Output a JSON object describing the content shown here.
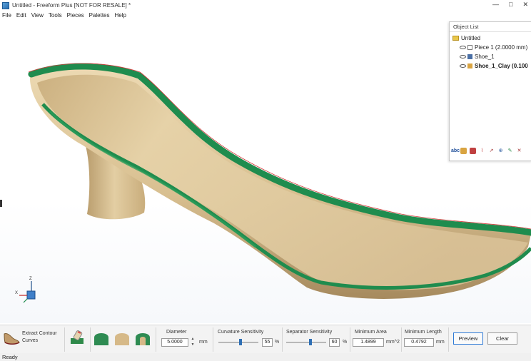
{
  "window": {
    "title": "Untitled - Freeform Plus [NOT FOR RESALE] *",
    "controls": [
      "—",
      "□",
      "✕"
    ]
  },
  "menu": [
    "File",
    "Edit",
    "View",
    "Tools",
    "Pieces",
    "Palettes",
    "Help"
  ],
  "object_list": {
    "header": "Object List",
    "root": "Untitled",
    "items": [
      {
        "label": "Piece 1 (2.0000 mm)",
        "icon": "piece-icon",
        "bold": false
      },
      {
        "label": "Shoe_1",
        "icon": "mesh-icon",
        "bold": false
      },
      {
        "label": "Shoe_1_Clay (0.100",
        "icon": "clay-icon",
        "bold": true
      }
    ],
    "toolbar_first": "abc"
  },
  "axis": {
    "x": "X",
    "z": "Z"
  },
  "toolbar": {
    "extract_label_line1": "Extract Contour",
    "extract_label_line2": "Curves",
    "diameter": {
      "label": "Diameter",
      "value": "5.0000",
      "unit": "mm"
    },
    "curvature": {
      "label": "Curvature Sensitivity",
      "value": "55",
      "unit": "%",
      "level": 0.55
    },
    "separator": {
      "label": "Separator Sensitivity",
      "value": "60",
      "unit": "%",
      "level": 0.6
    },
    "min_area": {
      "label": "Minimum Area",
      "value": "1.4899",
      "unit": "mm^2"
    },
    "min_length": {
      "label": "Minimum Length",
      "value": "0.4792",
      "unit": "mm"
    },
    "preview_label": "Preview",
    "clear_label": "Clear"
  },
  "status": "Ready",
  "colors": {
    "clay": "#ddc59a",
    "band": "#1f8c4e",
    "accent": "#2f7ad6"
  }
}
